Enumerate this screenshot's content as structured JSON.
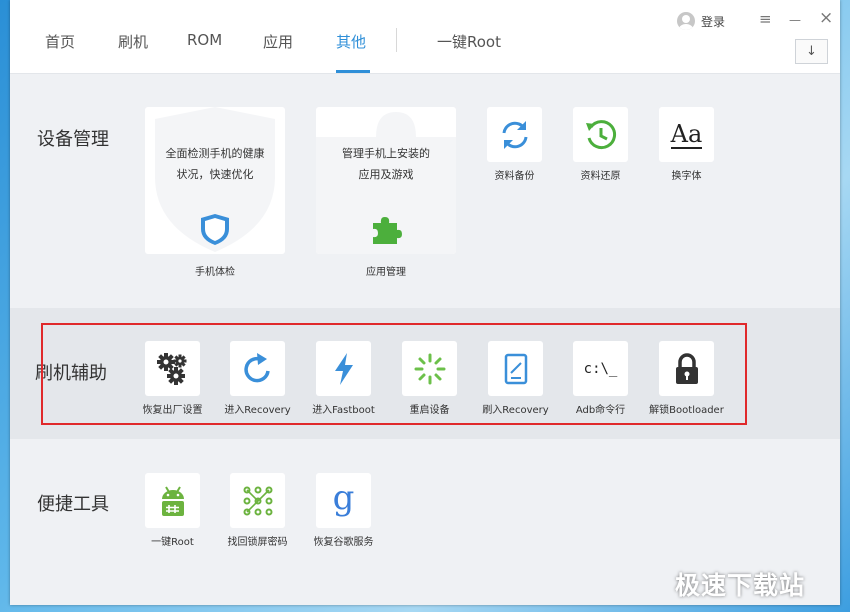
{
  "tabs": [
    "首页",
    "刷机",
    "ROM",
    "应用",
    "其他",
    "一键Root"
  ],
  "active_tab": "其他",
  "header": {
    "login": "登录",
    "menu_icon": "≡",
    "minimize": "—",
    "close": "×",
    "download_icon": "↓"
  },
  "sections": {
    "device": {
      "title": "设备管理",
      "big_cards": [
        {
          "desc_line1": "全面检测手机的健康",
          "desc_line2": "状况，快速优化",
          "label": "手机体检",
          "icon": "shield-icon"
        },
        {
          "desc_line1": "管理手机上安装的",
          "desc_line2": "应用及游戏",
          "label": "应用管理",
          "icon": "puzzle-icon"
        }
      ],
      "tools": [
        {
          "label": "资料备份",
          "icon": "sync-icon"
        },
        {
          "label": "资料还原",
          "icon": "restore-clock-icon"
        },
        {
          "label": "换字体",
          "icon": "font-icon",
          "glyph": "Aa"
        }
      ]
    },
    "flash": {
      "title": "刷机辅助",
      "tools": [
        {
          "label": "恢复出厂设置",
          "icon": "gears-icon"
        },
        {
          "label": "进入Recovery",
          "icon": "refresh-arrow-icon"
        },
        {
          "label": "进入Fastboot",
          "icon": "lightning-icon"
        },
        {
          "label": "重启设备",
          "icon": "loading-spinner-icon"
        },
        {
          "label": "刷入Recovery",
          "icon": "tablet-icon"
        },
        {
          "label": "Adb命令行",
          "icon": "command-prompt-icon",
          "glyph": "c:\\_"
        },
        {
          "label": "解锁Bootloader",
          "icon": "lock-icon"
        }
      ]
    },
    "tools": {
      "title": "便捷工具",
      "tools": [
        {
          "label": "一键Root",
          "icon": "android-root-icon"
        },
        {
          "label": "找回锁屏密码",
          "icon": "pattern-lock-icon"
        },
        {
          "label": "恢复谷歌服务",
          "icon": "google-g-icon",
          "glyph": "g"
        }
      ]
    }
  },
  "site_watermark": "极速下载站",
  "colors": {
    "accent": "#2f8fd8",
    "highlight_box": "#e0292b",
    "green": "#4caf3c"
  }
}
